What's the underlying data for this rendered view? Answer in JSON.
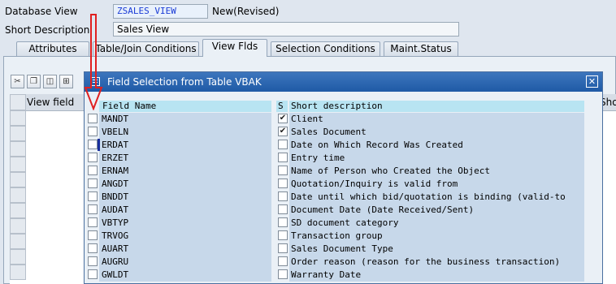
{
  "header": {
    "database_view_label": "Database View",
    "database_view_value": "ZSALES_VIEW",
    "status": "New(Revised)",
    "short_description_label": "Short Description",
    "short_description_value": "Sales View"
  },
  "tabs": [
    {
      "label": "Attributes",
      "active": false
    },
    {
      "label": "Table/Join Conditions",
      "active": false
    },
    {
      "label": "View Flds",
      "active": true
    },
    {
      "label": "Selection Conditions",
      "active": false
    },
    {
      "label": "Maint.Status",
      "active": false
    }
  ],
  "background_table": {
    "column_view_field": "View field",
    "column_short_cut": "Shor"
  },
  "dialog": {
    "title": "Field Selection from Table VBAK",
    "columns": {
      "field_name": "Field Name",
      "s": "S",
      "short_description": "Short description"
    },
    "rows": [
      {
        "field": "MANDT",
        "desc": "Client",
        "selected": false,
        "s_checked": true
      },
      {
        "field": "VBELN",
        "desc": "Sales Document",
        "selected": false,
        "s_checked": true
      },
      {
        "field": "ERDAT",
        "desc": "Date on Which Record Was Created",
        "selected": false,
        "s_checked": false
      },
      {
        "field": "ERZET",
        "desc": "Entry time",
        "selected": false,
        "s_checked": false
      },
      {
        "field": "ERNAM",
        "desc": "Name of Person who Created the Object",
        "selected": false,
        "s_checked": false
      },
      {
        "field": "ANGDT",
        "desc": "Quotation/Inquiry is valid from",
        "selected": false,
        "s_checked": false
      },
      {
        "field": "BNDDT",
        "desc": "Date until which bid/quotation is binding (valid-to",
        "selected": false,
        "s_checked": false
      },
      {
        "field": "AUDAT",
        "desc": "Document Date (Date Received/Sent)",
        "selected": false,
        "s_checked": false
      },
      {
        "field": "VBTYP",
        "desc": "SD document category",
        "selected": false,
        "s_checked": false
      },
      {
        "field": "TRVOG",
        "desc": "Transaction group",
        "selected": false,
        "s_checked": false
      },
      {
        "field": "AUART",
        "desc": "Sales Document Type",
        "selected": false,
        "s_checked": false
      },
      {
        "field": "AUGRU",
        "desc": "Order reason (reason for the business transaction)",
        "selected": false,
        "s_checked": false
      },
      {
        "field": "GWLDT",
        "desc": "Warranty Date",
        "selected": false,
        "s_checked": false
      }
    ]
  },
  "icons": {
    "toolbar": [
      "cut-icon",
      "copy-icon",
      "paste-icon",
      "insert-row-icon"
    ],
    "annotation": "red-arrow-icon"
  },
  "colors": {
    "title_bar": "#1f5aa6",
    "header_cell": "#b8e4f2",
    "row_cell": "#c7d8ea",
    "annotation": "#e02020"
  }
}
